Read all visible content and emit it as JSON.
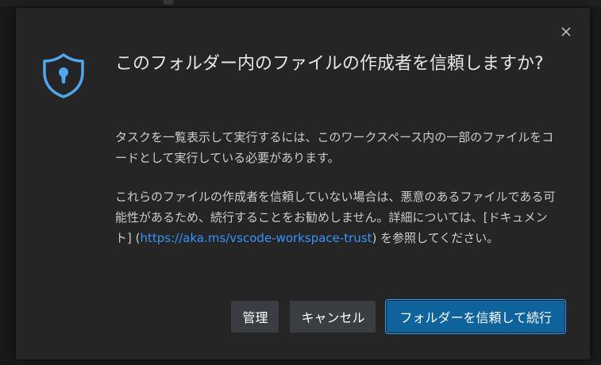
{
  "dialog": {
    "close_icon": "close-icon",
    "shield_icon": "shield-keyhole-icon",
    "title": "このフォルダー内のファイルの作成者を信頼しますか?",
    "message1": "タスクを一覧表示して実行するには、このワークスペース内の一部のファイルをコードとして実行している必要があります。",
    "message2_before": "これらのファイルの作成者を信頼していない場合は、悪意のあるファイルである可能性があるため、続行することをお勧めしません。詳細については、[ドキュメント] (",
    "message2_link": "https://aka.ms/vscode-workspace-trust",
    "message2_after": ") を参照してください。",
    "buttons": {
      "manage": "管理",
      "cancel": "キャンセル",
      "trust": "フォルダーを信頼して続行"
    }
  },
  "colors": {
    "dialog_bg": "#252526",
    "accent": "#3794ff",
    "primary_button": "#0e639c",
    "secondary_button": "#3a3d41",
    "shield": "#4fa8f0"
  }
}
